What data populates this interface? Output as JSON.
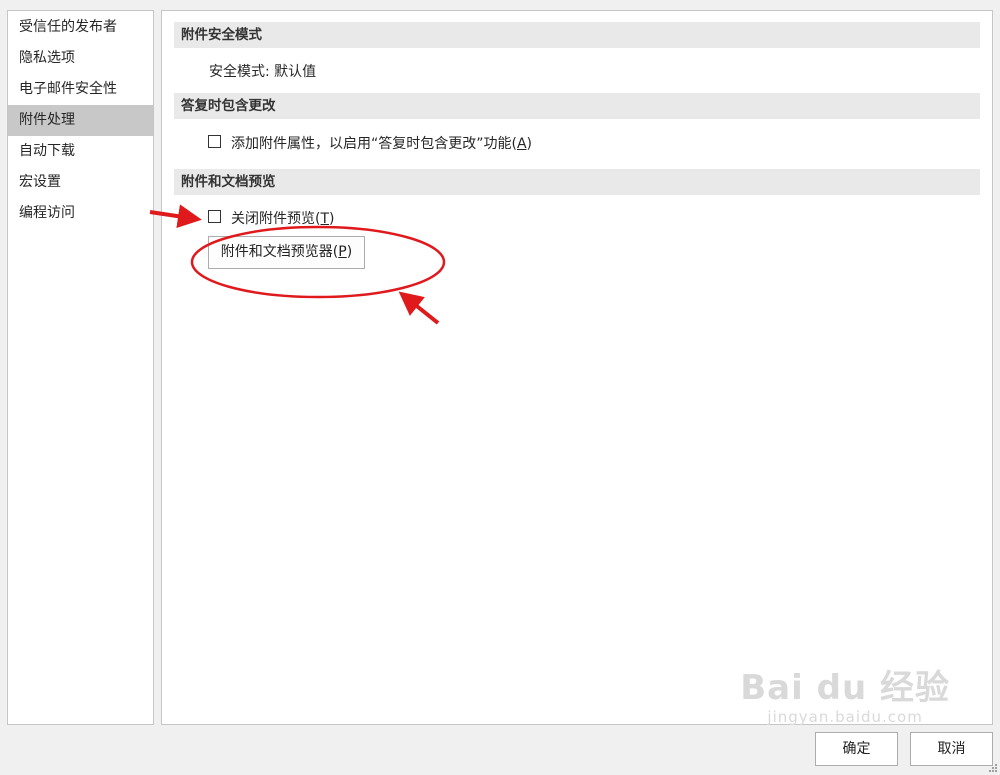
{
  "sidebar": {
    "items": [
      {
        "label": "受信任的发布者"
      },
      {
        "label": "隐私选项"
      },
      {
        "label": "电子邮件安全性"
      },
      {
        "label": "附件处理",
        "active": true
      },
      {
        "label": "自动下载"
      },
      {
        "label": "宏设置"
      },
      {
        "label": "编程访问"
      }
    ]
  },
  "main": {
    "section1": {
      "title": "附件安全模式",
      "value_text": "安全模式: 默认值"
    },
    "section2": {
      "title": "答复时包含更改",
      "checkbox": {
        "label_pre": "添加附件属性，以启用“答复时包含更改”功能(",
        "mnemonic": "A",
        "label_post": ")",
        "checked": false
      }
    },
    "section3": {
      "title": "附件和文档预览",
      "checkbox": {
        "label_pre": "关闭附件预览(",
        "mnemonic": "T",
        "label_post": ")",
        "checked": false
      },
      "button": {
        "label_pre": "附件和文档预览器(",
        "mnemonic": "P",
        "label_post": ")"
      }
    }
  },
  "footer": {
    "ok_label": "确定",
    "cancel_label": "取消"
  },
  "annotations": {
    "color": "#e0191c"
  },
  "watermark": {
    "logo": "Bai du 经验",
    "url": "jingyan.baidu.com"
  }
}
